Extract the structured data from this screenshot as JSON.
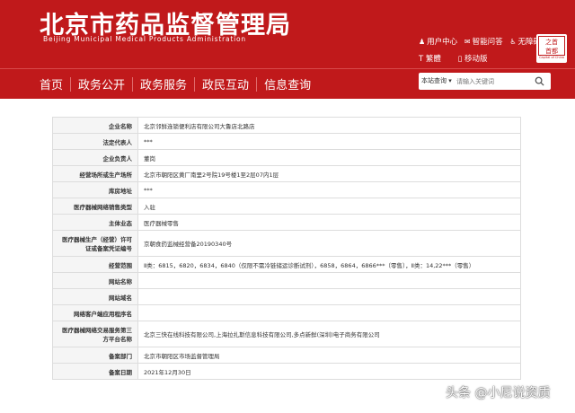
{
  "header": {
    "site_title": "北京市药品监督管理局",
    "site_subtitle": "Beijing Municipal Medical Products Administration",
    "links_row1": [
      {
        "icon": "user-icon",
        "glyph": "♟",
        "label": "用户中心"
      },
      {
        "icon": "qa-icon",
        "glyph": "✉",
        "label": "智能问答"
      },
      {
        "icon": "accessibility-icon",
        "glyph": "♿",
        "label": "无障碍"
      }
    ],
    "links_row2": [
      {
        "icon": "traditional-chinese-icon",
        "glyph": "T",
        "label": "繁體"
      },
      {
        "icon": "mobile-icon",
        "glyph": "▯",
        "label": "移动版"
      }
    ],
    "logo": {
      "line1": "之首",
      "line2": "首都",
      "caption": "Capital of China"
    },
    "colors": {
      "brand_red": "#c0191b"
    }
  },
  "nav": {
    "items": [
      "首页",
      "政务公开",
      "政务服务",
      "政民互动",
      "信息查询"
    ]
  },
  "search": {
    "scope": "本站查询",
    "placeholder": "请输入关键词"
  },
  "record": [
    {
      "label": "企业名称",
      "value": "北京邻鲜连锁便利店有限公司大鲁店北路店"
    },
    {
      "label": "法定代表人",
      "value": "***"
    },
    {
      "label": "企业负责人",
      "value": "董岗"
    },
    {
      "label": "经营场所或生产场所",
      "value": "北京市朝阳区黄厂南里2号院19号楼1至2层07内1层"
    },
    {
      "label": "库房地址",
      "value": "***"
    },
    {
      "label": "医疗器械网络销售类型",
      "value": "入驻"
    },
    {
      "label": "主体业态",
      "value": "医疗器械零售"
    },
    {
      "label": "医疗器械生产（经营）许可证或备案凭证编号",
      "value": "京朝食药监械经营备20190340号"
    },
    {
      "label": "经营范围",
      "value": "Ⅱ类：6815，6820，6834，6840（仅限不需冷链储运诊断试剂），6858，6864，6866***（零售），Ⅱ类：14,22***（零售）"
    },
    {
      "label": "网站名称",
      "value": ""
    },
    {
      "label": "网站域名",
      "value": ""
    },
    {
      "label": "网络客户端应用程序名",
      "value": ""
    },
    {
      "label": "医疗器械网络交易服务第三方平台名称",
      "value": "北京三快在线科技有限公司,上海拉扎斯信息科技有限公司,多点新鲜(深圳)电子商务有限公司"
    },
    {
      "label": "备案部门",
      "value": "北京市朝阳区市场监督管理局"
    },
    {
      "label": "备案日期",
      "value": "2021年12月30日"
    }
  ],
  "watermark": "头条 @小尼说资质"
}
